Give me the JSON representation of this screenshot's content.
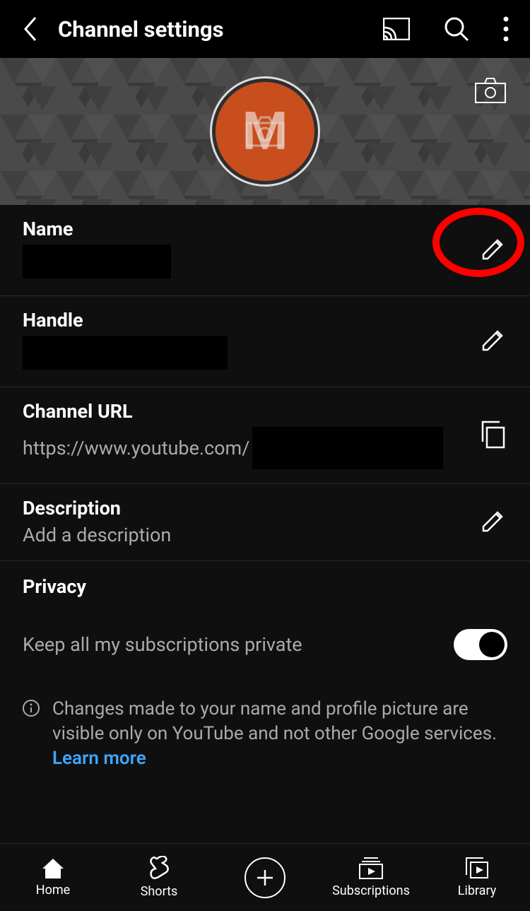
{
  "header": {
    "title": "Channel settings"
  },
  "avatar": {
    "letter": "M"
  },
  "fields": {
    "name": {
      "label": "Name",
      "value": ""
    },
    "handle": {
      "label": "Handle",
      "value": ""
    },
    "channel_url": {
      "label": "Channel URL",
      "prefix": "https://www.youtube.com/"
    },
    "description": {
      "label": "Description",
      "placeholder": "Add a description"
    }
  },
  "privacy": {
    "title": "Privacy",
    "toggle_label": "Keep all my subscriptions private",
    "toggle_on": true
  },
  "info": {
    "text": "Changes made to your name and profile picture are visible only on YouTube and not other Google services.",
    "learn_more": "Learn more"
  },
  "nav": {
    "home": "Home",
    "shorts": "Shorts",
    "subscriptions": "Subscriptions",
    "library": "Library"
  }
}
